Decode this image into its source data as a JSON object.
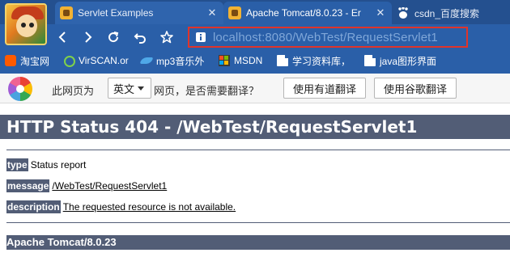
{
  "browser": {
    "tabs": [
      {
        "label": "Servlet Examples",
        "icon": "tomcat-icon",
        "active": false
      },
      {
        "label": "Apache Tomcat/8.0.23 - Er",
        "icon": "tomcat-icon",
        "active": true
      },
      {
        "label": "csdn_百度搜索",
        "icon": "baidu-paw-icon",
        "active": false
      }
    ],
    "close_glyph": "✕",
    "url": "localhost:8080/WebTest/RequestServlet1",
    "url_highlight_color": "#e0342a",
    "chrome_color": "#2a5fa8",
    "bookmarks": [
      {
        "label": "淘宝网",
        "icon": "taobao-icon"
      },
      {
        "label": "VirSCAN.or",
        "icon": "virscan-icon"
      },
      {
        "label": "mp3音乐外",
        "icon": "mp3-icon"
      },
      {
        "label": "MSDN",
        "icon": "msdn-icon"
      },
      {
        "label": "学习资料库，",
        "icon": "document-icon"
      },
      {
        "label": "java图形界面",
        "icon": "document-icon"
      }
    ]
  },
  "translate_bar": {
    "prefix": "此网页为",
    "language": "英文",
    "suffix": "网页，是否需要翻译？",
    "youdao_button": "使用有道翻译",
    "google_button": "使用谷歌翻译"
  },
  "page": {
    "title": "HTTP Status 404 - /WebTest/RequestServlet1",
    "type_label": "type",
    "type_value": "Status report",
    "message_label": "message",
    "message_value": "/WebTest/RequestServlet1",
    "description_label": "description",
    "description_value": "The requested resource is not available.",
    "footer": "Apache Tomcat/8.0.23",
    "accent_color": "#525d76"
  }
}
